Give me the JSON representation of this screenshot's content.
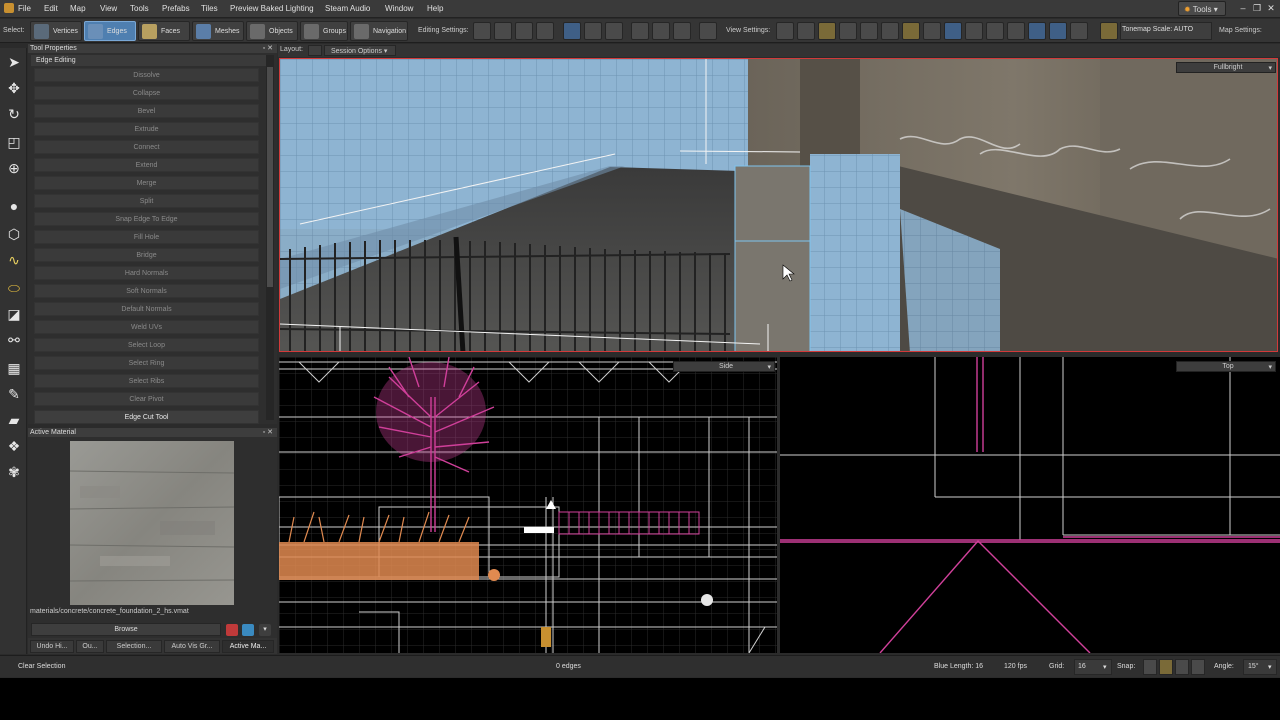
{
  "menubar": {
    "items": [
      "File",
      "Edit",
      "Map",
      "View",
      "Tools",
      "Prefabs",
      "Tiles",
      "Preview Baked Lighting",
      "Steam Audio",
      "Window",
      "Help"
    ],
    "tools_dropdown": "Tools"
  },
  "toolbar": {
    "select_label": "Select:",
    "modes": [
      "Vertices",
      "Edges",
      "Faces",
      "Meshes",
      "Objects",
      "Groups",
      "Navigation"
    ],
    "active_mode": "Edges",
    "editing_settings_label": "Editing Settings:",
    "view_settings_label": "View Settings:",
    "tonemap_label": "Tonemap Scale: AUTO",
    "map_settings_label": "Map Settings:"
  },
  "tool_properties": {
    "title": "Tool Properties",
    "section": "Edge Editing",
    "buttons": [
      "Dissolve",
      "Collapse",
      "Bevel",
      "Extrude",
      "Connect",
      "Extend",
      "Merge",
      "Split",
      "Snap Edge To Edge",
      "Fill Hole",
      "Bridge",
      "Hard Normals",
      "Soft Normals",
      "Default Normals",
      "Weld UVs",
      "Select Loop",
      "Select Ring",
      "Select Ribs",
      "Clear Pivot",
      "Edge Cut Tool"
    ],
    "active_button": "Edge Cut Tool"
  },
  "active_material": {
    "title": "Active Material",
    "path": "materials/concrete/concrete_foundation_2_hs.vmat",
    "browse_label": "Browse",
    "tabs": [
      "Undo Hi...",
      "Ou...",
      "Selection...",
      "Auto Vis Gr...",
      "Active Ma..."
    ],
    "active_tab": "Active Ma..."
  },
  "layout": {
    "label": "Layout:",
    "session_options": "Session Options"
  },
  "viewports": {
    "perspective_mode": "Fullbright",
    "side_label": "Side",
    "top_label": "Top"
  },
  "statusbar": {
    "left_text": "Clear Selection",
    "selection_count": "0 edges",
    "blue_length": "Blue Length: 16",
    "fps": "120 fps",
    "grid_label": "Grid:",
    "grid_value": "16",
    "snap_label": "Snap:",
    "angle_label": "Angle:",
    "angle_value": "15°"
  },
  "colors": {
    "accent_blue": "#4f7fb0",
    "selection_red": "#d23a3a",
    "magenta_geometry": "#d0409a",
    "orange_geometry": "#e08a50"
  }
}
